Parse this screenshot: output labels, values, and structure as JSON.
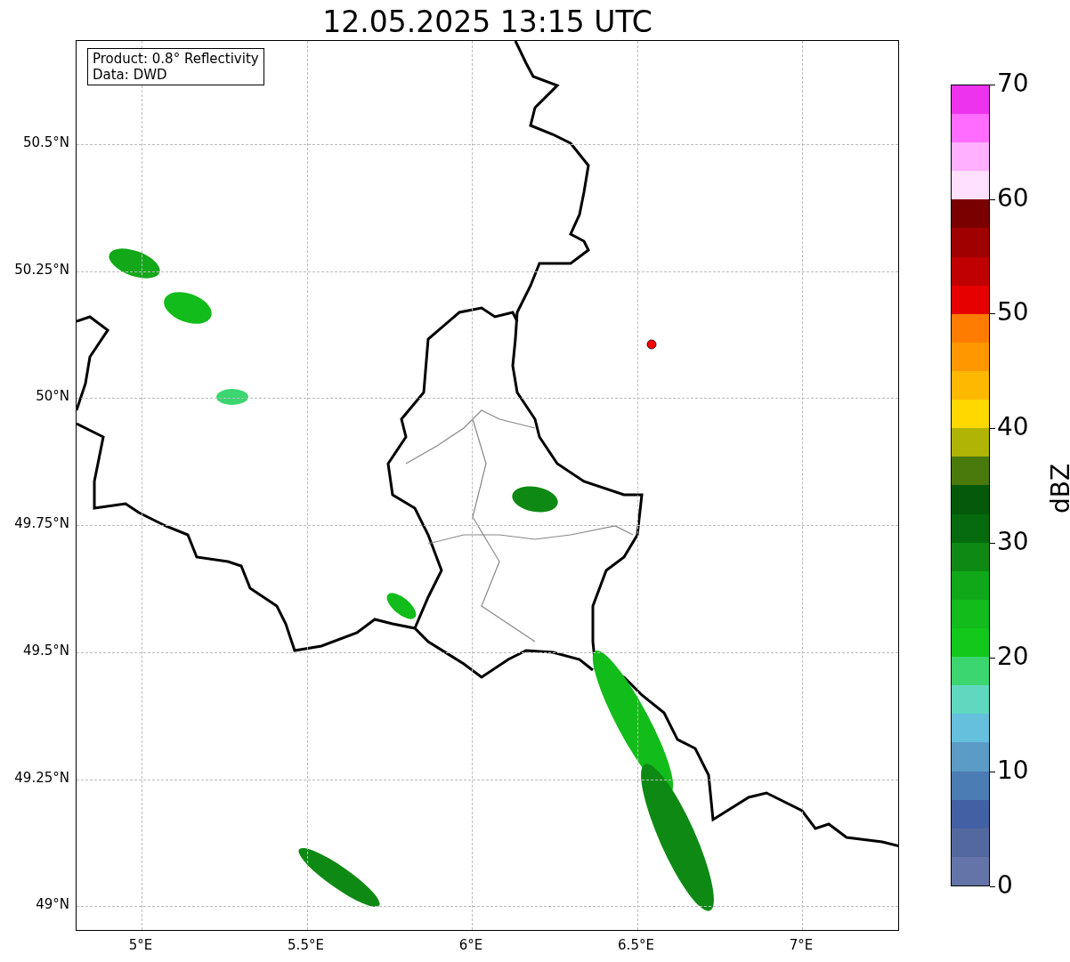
{
  "title": "12.05.2025 13:15 UTC",
  "map": {
    "legend": [
      "Product: 0.8° Reflectivity",
      "Data: DWD"
    ],
    "y_ticks": [
      "50.5°N",
      "50.25°N",
      "50°N",
      "49.75°N",
      "49.5°N",
      "49.25°N",
      "49°N"
    ],
    "x_ticks": [
      "5°E",
      "5.5°E",
      "6°E",
      "6.5°E",
      "7°E"
    ]
  },
  "colorbar": {
    "label": "dBZ",
    "ticks": [
      "70",
      "60",
      "50",
      "40",
      "30",
      "20",
      "10",
      "0"
    ],
    "segments": [
      {
        "color": "#6474a8"
      },
      {
        "color": "#5468a0"
      },
      {
        "color": "#4460a4"
      },
      {
        "color": "#4c7cb4"
      },
      {
        "color": "#5a9cc6"
      },
      {
        "color": "#64c0dc"
      },
      {
        "color": "#60d8c0"
      },
      {
        "color": "#3cd670"
      },
      {
        "color": "#12c81a"
      },
      {
        "color": "#12bc1a"
      },
      {
        "color": "#10a818"
      },
      {
        "color": "#0e8a14"
      },
      {
        "color": "#066a0e"
      },
      {
        "color": "#045a0a"
      },
      {
        "color": "#4a7a0c"
      },
      {
        "color": "#b0b404"
      },
      {
        "color": "#ffd800"
      },
      {
        "color": "#ffb800"
      },
      {
        "color": "#ff9800"
      },
      {
        "color": "#ff7c00"
      },
      {
        "color": "#e60000"
      },
      {
        "color": "#c00000"
      },
      {
        "color": "#a00000"
      },
      {
        "color": "#7a0000"
      },
      {
        "color": "#ffe0ff"
      },
      {
        "color": "#ffb0ff"
      },
      {
        "color": "#ff6cff"
      },
      {
        "color": "#ee33ee"
      }
    ]
  }
}
